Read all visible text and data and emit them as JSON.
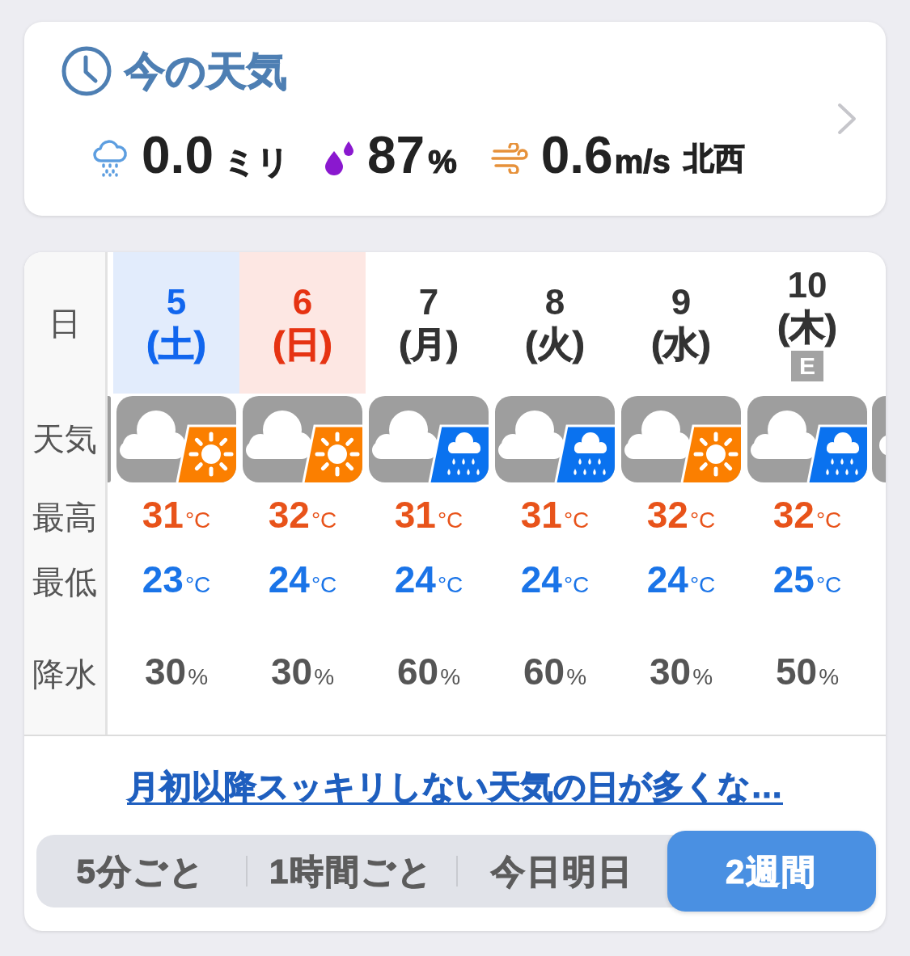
{
  "current_weather": {
    "title": "今の天気",
    "readings": [
      {
        "kind": "rain",
        "value": "0.0",
        "unit": "ミリ"
      },
      {
        "kind": "humidity",
        "value": "87",
        "unit": "%"
      },
      {
        "kind": "wind",
        "value": "0.6",
        "unit": "m/s",
        "direction": "北西"
      }
    ]
  },
  "forecast": {
    "row_labels": [
      "日",
      "天気",
      "最高",
      "最低",
      "降水"
    ],
    "days": [
      {
        "date": "5",
        "weekday": "(土)",
        "kind": "saturday",
        "weather": {
          "kind": "cloud_sun"
        },
        "high": {
          "value": "31",
          "unit": "°C"
        },
        "low": {
          "value": "23",
          "unit": "°C"
        },
        "precip": {
          "value": "30",
          "unit": "%"
        }
      },
      {
        "date": "6",
        "weekday": "(日)",
        "kind": "sunday",
        "weather": {
          "kind": "cloud_sun"
        },
        "high": {
          "value": "32",
          "unit": "°C"
        },
        "low": {
          "value": "24",
          "unit": "°C"
        },
        "precip": {
          "value": "30",
          "unit": "%"
        }
      },
      {
        "date": "7",
        "weekday": "(月)",
        "kind": "weekday",
        "weather": {
          "kind": "cloud_rain"
        },
        "high": {
          "value": "31",
          "unit": "°C"
        },
        "low": {
          "value": "24",
          "unit": "°C"
        },
        "precip": {
          "value": "60",
          "unit": "%"
        }
      },
      {
        "date": "8",
        "weekday": "(火)",
        "kind": "weekday",
        "weather": {
          "kind": "cloud_rain"
        },
        "high": {
          "value": "31",
          "unit": "°C"
        },
        "low": {
          "value": "24",
          "unit": "°C"
        },
        "precip": {
          "value": "60",
          "unit": "%"
        }
      },
      {
        "date": "9",
        "weekday": "(水)",
        "kind": "weekday",
        "weather": {
          "kind": "cloud_sun"
        },
        "high": {
          "value": "32",
          "unit": "°C"
        },
        "low": {
          "value": "24",
          "unit": "°C"
        },
        "precip": {
          "value": "30",
          "unit": "%"
        }
      },
      {
        "date": "10",
        "weekday": "(木)",
        "kind": "weekday",
        "badge": "E",
        "weather": {
          "kind": "cloud_rain"
        },
        "high": {
          "value": "32",
          "unit": "°C"
        },
        "low": {
          "value": "25",
          "unit": "°C"
        },
        "precip": {
          "value": "50",
          "unit": "%"
        }
      }
    ]
  },
  "news_link": "月初以降スッキリしない天気の日が多くな…",
  "tabs": [
    {
      "label": "5分ごと",
      "selected": false
    },
    {
      "label": "1時間ごと",
      "selected": false
    },
    {
      "label": "今日明日",
      "selected": false
    },
    {
      "label": "2週間",
      "selected": true
    }
  ]
}
